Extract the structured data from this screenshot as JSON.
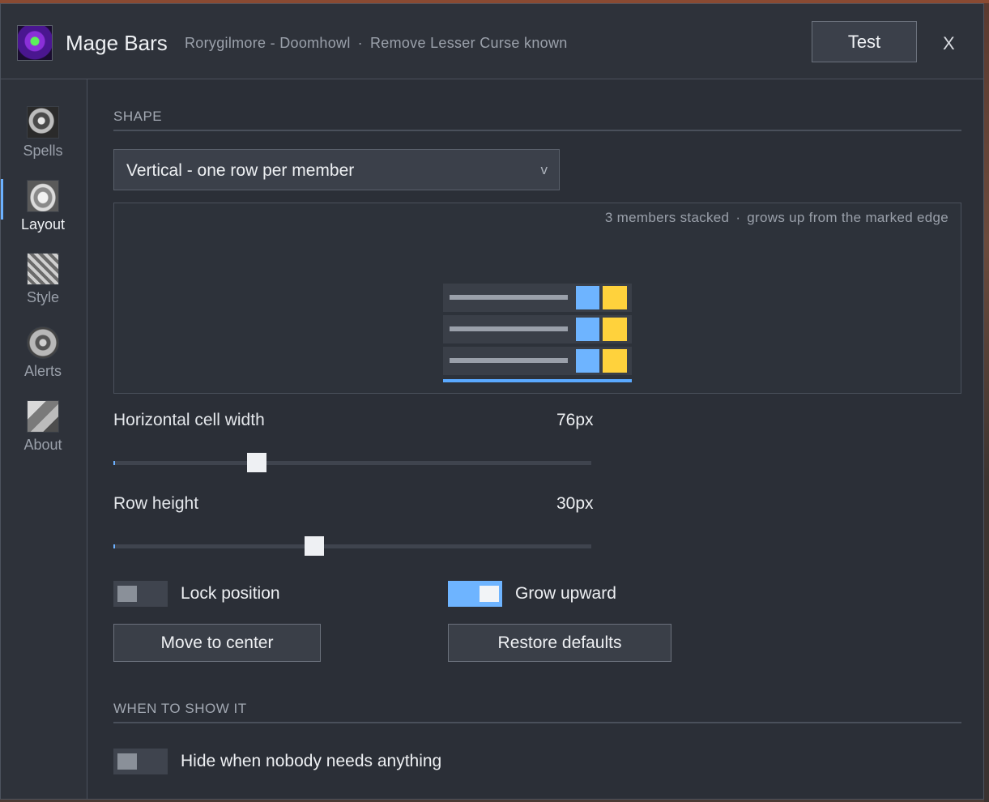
{
  "window": {
    "title": "Mage Bars",
    "character": "Rorygilmore - Doomhowl",
    "separator": "·",
    "status": "Remove Lesser Curse known",
    "test_label": "Test",
    "close_label": "X"
  },
  "sidebar": {
    "items": [
      {
        "label": "Spells",
        "icon": "spells-icon"
      },
      {
        "label": "Layout",
        "icon": "layout-icon",
        "active": true
      },
      {
        "label": "Style",
        "icon": "style-icon"
      },
      {
        "label": "Alerts",
        "icon": "alerts-icon"
      },
      {
        "label": "About",
        "icon": "about-icon"
      }
    ]
  },
  "shape": {
    "header": "SHAPE",
    "selected": "Vertical - one row per member",
    "chevron": "v",
    "preview_count": "3 members stacked",
    "preview_sep": "·",
    "preview_growth": "grows up from the marked edge"
  },
  "sliders": {
    "cell_width": {
      "label": "Horizontal cell width",
      "value": "76px",
      "position": 0.3
    },
    "row_height": {
      "label": "Row height",
      "value": "30px",
      "position": 0.42
    }
  },
  "toggles": {
    "lock": {
      "label": "Lock position",
      "on": false
    },
    "grow": {
      "label": "Grow upward",
      "on": true
    },
    "hide": {
      "label": "Hide when nobody needs anything",
      "on": false
    }
  },
  "buttons": {
    "center": "Move to center",
    "restore": "Restore defaults"
  },
  "visibility": {
    "header": "WHEN TO SHOW IT"
  },
  "colors": {
    "accent": "#6eb4ff",
    "yellow": "#ffd23c",
    "panel": "#2d3139"
  }
}
